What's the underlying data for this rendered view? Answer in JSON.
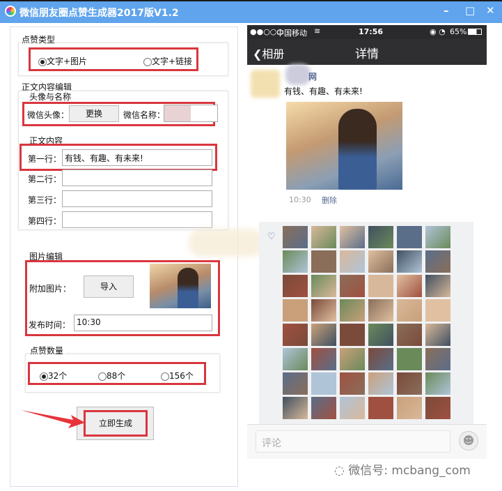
{
  "window": {
    "title": "微信朋友圈点赞生成器2017版V1.2",
    "minimize": "–",
    "maximize": "□",
    "close": "✕"
  },
  "like_type": {
    "label": "点赞类型",
    "options": [
      {
        "label": "文字+图片",
        "selected": true
      },
      {
        "label": "文字+链接",
        "selected": false
      }
    ]
  },
  "content_edit": {
    "label": "正文内容编辑"
  },
  "avatar_name": {
    "label": "头像与名称",
    "avatar_label": "微信头像：",
    "change_button": "更换",
    "name_label": "微信名称："
  },
  "body_text": {
    "label": "正文内容",
    "rows": [
      {
        "label": "第一行：",
        "value": "有钱、有趣、有未来!"
      },
      {
        "label": "第二行：",
        "value": ""
      },
      {
        "label": "第三行：",
        "value": ""
      },
      {
        "label": "第四行：",
        "value": ""
      }
    ]
  },
  "image_edit": {
    "label": "图片编辑",
    "attach_label": "附加图片：",
    "import_button": "导入",
    "time_label": "发布时间：",
    "time_value": "10:30"
  },
  "like_count": {
    "label": "点赞数量",
    "options": [
      {
        "label": "32个",
        "selected": true
      },
      {
        "label": "88个",
        "selected": false
      },
      {
        "label": "156个",
        "selected": false
      }
    ]
  },
  "generate_button": "立即生成",
  "phone": {
    "signal": "●●○○○",
    "carrier": "中国移动",
    "time": "17:56",
    "battery": "65%",
    "back_label": "相册",
    "nav_title": "详情",
    "post_name": "网",
    "post_text": "有钱、有趣、有未来!",
    "post_time": "10:30",
    "delete_label": "删除",
    "comment_placeholder": "评论"
  },
  "watermark": "微信号: mcbang_com",
  "colors": {
    "titlebar": "#5fa4ec",
    "highlight": "#d9363e",
    "wechat_link": "#576b95"
  }
}
